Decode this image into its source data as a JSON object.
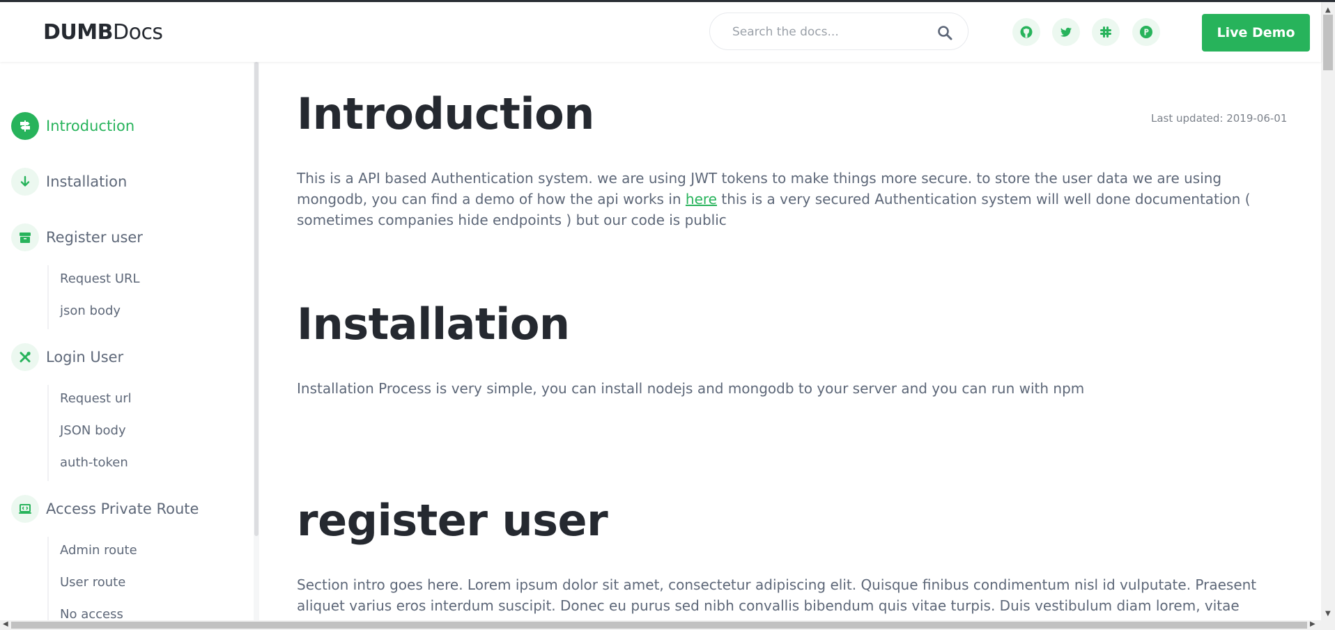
{
  "header": {
    "brand_bold": "DUMB",
    "brand_light": "Docs",
    "search_placeholder": "Search the docs...",
    "social_icons": [
      "github-icon",
      "twitter-icon",
      "slack-icon",
      "product-hunt-icon"
    ],
    "demo_button": "Live Demo"
  },
  "sidebar": {
    "items": [
      {
        "label": "Introduction",
        "icon": "signpost-icon",
        "active": true
      },
      {
        "label": "Installation",
        "icon": "arrow-down-icon"
      },
      {
        "label": "Register user",
        "icon": "box-icon",
        "children": [
          "Request URL",
          "json body"
        ]
      },
      {
        "label": "Login User",
        "icon": "tools-icon",
        "children": [
          "Request url",
          "JSON body",
          "auth-token"
        ]
      },
      {
        "label": "Access Private Route",
        "icon": "laptop-code-icon",
        "children": [
          "Admin route",
          "User route",
          "No access"
        ]
      }
    ]
  },
  "content": {
    "intro": {
      "title": "Introduction",
      "updated": "Last updated: 2019-06-01",
      "text_before_link": "This is a API based Authentication system. we are using JWT tokens to make things more secure. to store the user data we are using mongodb, you can find a demo of how the api works in ",
      "link_text": "here",
      "text_after_link": " this is a very secured Authentication system will well done documentation ( sometimes companies hide endpoints ) but our code is public"
    },
    "installation": {
      "title": "Installation",
      "text": "Installation Process is very simple, you can install nodejs and mongodb to your server and you can run with npm"
    },
    "register": {
      "title": "register user",
      "text": "Section intro goes here. Lorem ipsum dolor sit amet, consectetur adipiscing elit. Quisque finibus condimentum nisl id vulputate. Praesent aliquet varius eros interdum suscipit. Donec eu purus sed nibh convallis bibendum quis vitae turpis. Duis vestibulum diam lorem, vitae"
    }
  },
  "colors": {
    "accent": "#27b35b",
    "heading": "#252930",
    "body_text": "#5d6778",
    "icon_bg": "#ecf8f0"
  }
}
